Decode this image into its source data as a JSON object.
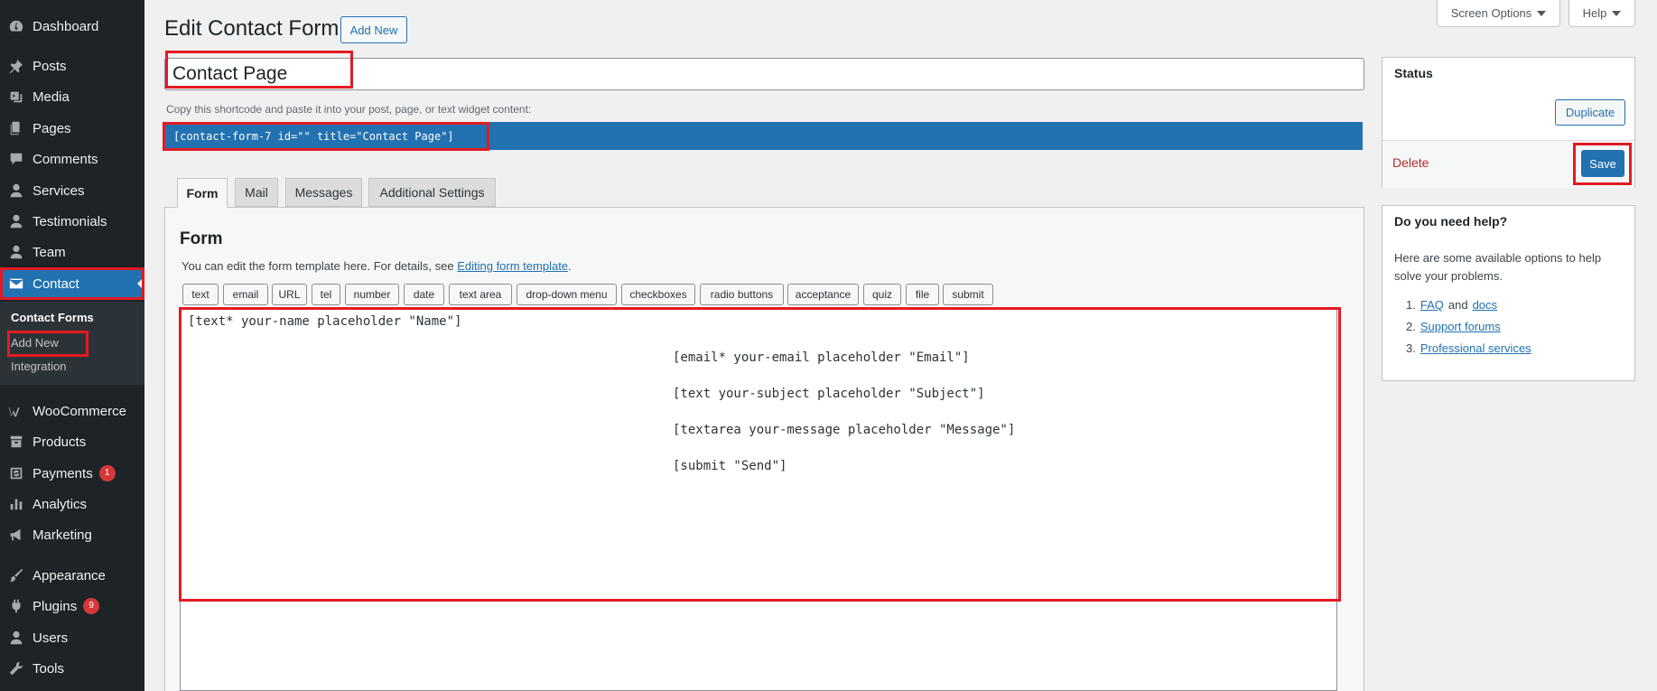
{
  "sidebar": {
    "items": [
      {
        "label": "Dashboard",
        "icon": "dashboard-icon"
      },
      {
        "label": "Posts",
        "icon": "pin-icon"
      },
      {
        "label": "Media",
        "icon": "media-icon"
      },
      {
        "label": "Pages",
        "icon": "pages-icon"
      },
      {
        "label": "Comments",
        "icon": "comment-icon"
      },
      {
        "label": "Services",
        "icon": "user-icon"
      },
      {
        "label": "Testimonials",
        "icon": "user-icon"
      },
      {
        "label": "Team",
        "icon": "user-icon"
      },
      {
        "label": "Contact",
        "icon": "envelope-icon"
      },
      {
        "label": "WooCommerce",
        "icon": "woo-icon"
      },
      {
        "label": "Products",
        "icon": "archive-icon"
      },
      {
        "label": "Payments",
        "icon": "dollar-icon",
        "badge": "1"
      },
      {
        "label": "Analytics",
        "icon": "chart-icon"
      },
      {
        "label": "Marketing",
        "icon": "megaphone-icon"
      },
      {
        "label": "Appearance",
        "icon": "brush-icon"
      },
      {
        "label": "Plugins",
        "icon": "plugin-icon",
        "badge": "9"
      },
      {
        "label": "Users",
        "icon": "user-icon"
      },
      {
        "label": "Tools",
        "icon": "wrench-icon"
      }
    ],
    "submenu": [
      "Contact Forms",
      "Add New",
      "Integration"
    ]
  },
  "header": {
    "title": "Edit Contact Form",
    "add_new": "Add New",
    "screen_options": "Screen Options",
    "help": "Help"
  },
  "form": {
    "title_value": "Contact Page",
    "shortcode_hint": "Copy this shortcode and paste it into your post, page, or text widget content:",
    "shortcode": "[contact-form-7 id=\"\" title=\"Contact Page\"]",
    "tabs": [
      "Form",
      "Mail",
      "Messages",
      "Additional Settings"
    ],
    "panel_heading": "Form",
    "desc_prefix": "You can edit the form template here. For details, see ",
    "desc_link": "Editing form template",
    "desc_suffix": ".",
    "tag_buttons": [
      "text",
      "email",
      "URL",
      "tel",
      "number",
      "date",
      "text area",
      "drop-down menu",
      "checkboxes",
      "radio buttons",
      "acceptance",
      "quiz",
      "file",
      "submit"
    ],
    "template_lines": [
      "[text* your-name placeholder \"Name\"]",
      "[email* your-email placeholder \"Email\"]",
      "[text your-subject placeholder \"Subject\"]",
      "[textarea your-message placeholder \"Message\"]",
      "[submit \"Send\"]"
    ]
  },
  "status_box": {
    "title": "Status",
    "duplicate": "Duplicate",
    "delete": "Delete",
    "save": "Save"
  },
  "help_box": {
    "title": "Do you need help?",
    "text": "Here are some available options to help solve your problems.",
    "item1_a": "FAQ",
    "item1_and": "and",
    "item1_b": "docs",
    "item2": "Support forums",
    "item3": "Professional services"
  },
  "colors": {
    "sidebar_bg": "#1d2327",
    "accent": "#2271b1",
    "highlight": "#e31b23",
    "delete": "#b32d2e"
  }
}
